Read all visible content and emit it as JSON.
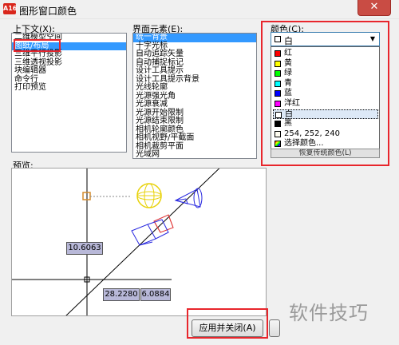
{
  "window": {
    "app_badge": "A16",
    "title": "图形窗口颜色",
    "close_glyph": "✕"
  },
  "context": {
    "label": "上下文(X):",
    "items": [
      "二维模型空间",
      "图纸/布局",
      "三维平行投影",
      "三维透视投影",
      "块编辑器",
      "命令行",
      "打印预览"
    ],
    "selected_index": 1
  },
  "interface_elements": {
    "label": "界面元素(E):",
    "items": [
      "统一背景",
      "十字光标",
      "自动追踪矢量",
      "自动捕捉标记",
      "设计工具提示",
      "设计工具提示背景",
      "光线轮廓",
      "光源强光角",
      "光源衰减",
      "光源开始限制",
      "光源结束限制",
      "相机轮廓颜色",
      "相机视野/平截面",
      "相机裁剪平面",
      "光域网"
    ],
    "selected_index": 0
  },
  "color": {
    "label": "颜色(C):",
    "selected": "白",
    "options": [
      {
        "label": "红",
        "color": "#ff0000"
      },
      {
        "label": "黄",
        "color": "#ffff00"
      },
      {
        "label": "绿",
        "color": "#00ff00"
      },
      {
        "label": "青",
        "color": "#00ffff"
      },
      {
        "label": "蓝",
        "color": "#0000ff"
      },
      {
        "label": "洋红",
        "color": "#ff00ff"
      },
      {
        "label": "白",
        "color": "#ffffff"
      },
      {
        "label": "黑",
        "color": "#000000"
      },
      {
        "label": "254, 252, 240",
        "color": "#fefcf0"
      },
      {
        "label": "选择颜色...",
        "color": "multicolor"
      }
    ],
    "hidden_button": "恢复传统颜色(L)"
  },
  "preview": {
    "label": "预览:",
    "readout_1": "10.6063",
    "readout_2": "28.2280",
    "readout_3": "6.0884"
  },
  "buttons": {
    "apply_close": "应用并关闭(A)"
  },
  "watermark": "软件技巧",
  "accent_colors": {
    "highlight_box": "#e8262c",
    "selection": "#3399ff",
    "preview_blue": "#2a2ae0"
  }
}
